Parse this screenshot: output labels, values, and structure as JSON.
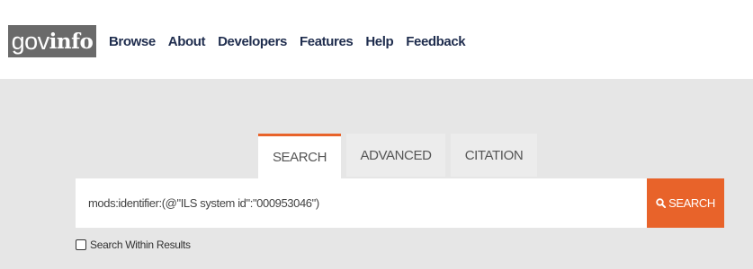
{
  "header": {
    "logo": {
      "light": "gov",
      "bold": "info"
    },
    "nav": [
      "Browse",
      "About",
      "Developers",
      "Features",
      "Help",
      "Feedback"
    ]
  },
  "tabs": [
    {
      "label": "SEARCH",
      "active": true
    },
    {
      "label": "ADVANCED",
      "active": false
    },
    {
      "label": "CITATION",
      "active": false
    }
  ],
  "search": {
    "query": "mods:identifier:(@\"ILS system id\":\"000953046\")",
    "button_label": "SEARCH",
    "button_icon": "search-icon"
  },
  "within_results": {
    "label": "Search Within Results",
    "checked": false
  },
  "colors": {
    "accent": "#e8632a",
    "nav_text": "#1f2d4e",
    "logo_bg": "#6a6a6a"
  }
}
